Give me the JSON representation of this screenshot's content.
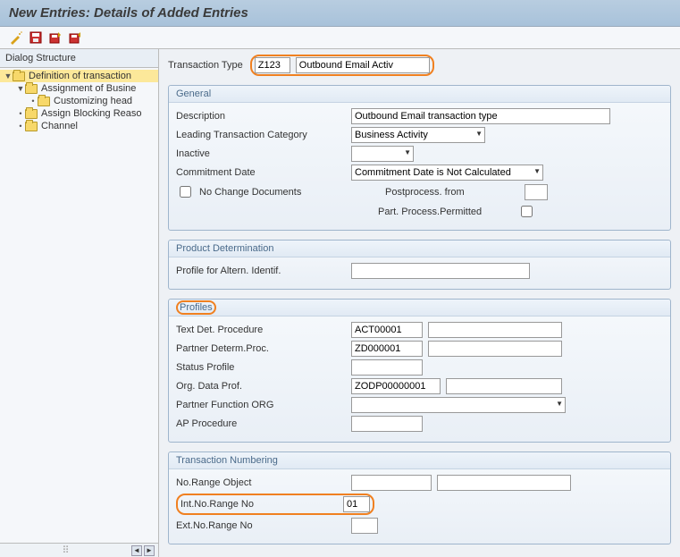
{
  "window": {
    "title": "New Entries: Details of Added Entries"
  },
  "sidebar": {
    "header": "Dialog Structure",
    "items": [
      {
        "label": "Definition of transaction",
        "indent": 1,
        "active": true,
        "expander": "▼"
      },
      {
        "label": "Assignment of Busine",
        "indent": 2,
        "active": false,
        "expander": "▼"
      },
      {
        "label": "Customizing head",
        "indent": 3,
        "active": false,
        "expander": "•"
      },
      {
        "label": "Assign Blocking Reaso",
        "indent": 2,
        "active": false,
        "expander": "•"
      },
      {
        "label": "Channel",
        "indent": 2,
        "active": false,
        "expander": "•"
      }
    ]
  },
  "top": {
    "label": "Transaction Type",
    "code": "Z123",
    "desc": "Outbound Email Activ"
  },
  "general": {
    "title": "General",
    "description_label": "Description",
    "description_value": "Outbound Email transaction type",
    "leading_cat_label": "Leading Transaction Category",
    "leading_cat_value": "Business Activity",
    "inactive_label": "Inactive",
    "inactive_value": "",
    "commit_label": "Commitment Date",
    "commit_value": "Commitment Date is Not Calculated",
    "nochange_label": "No Change Documents",
    "postproc_label": "Postprocess. from",
    "postproc_value": "",
    "partproc_label": "Part. Process.Permitted"
  },
  "prod": {
    "title": "Product Determination",
    "profile_label": "Profile for Altern. Identif.",
    "profile_value": ""
  },
  "profiles": {
    "title": "Profiles",
    "text_det_label": "Text Det. Procedure",
    "text_det_value": "ACT00001",
    "partner_label": "Partner Determ.Proc.",
    "partner_value": "ZD000001",
    "status_label": "Status Profile",
    "status_value": "",
    "org_label": "Org. Data Prof.",
    "org_value": "ZODP00000001",
    "pforg_label": "Partner Function ORG",
    "pforg_value": "",
    "ap_label": "AP Procedure",
    "ap_value": ""
  },
  "numbering": {
    "title": "Transaction Numbering",
    "obj_label": "No.Range Object",
    "obj_value": "",
    "int_label": "Int.No.Range No",
    "int_value": "01",
    "ext_label": "Ext.No.Range No",
    "ext_value": ""
  }
}
